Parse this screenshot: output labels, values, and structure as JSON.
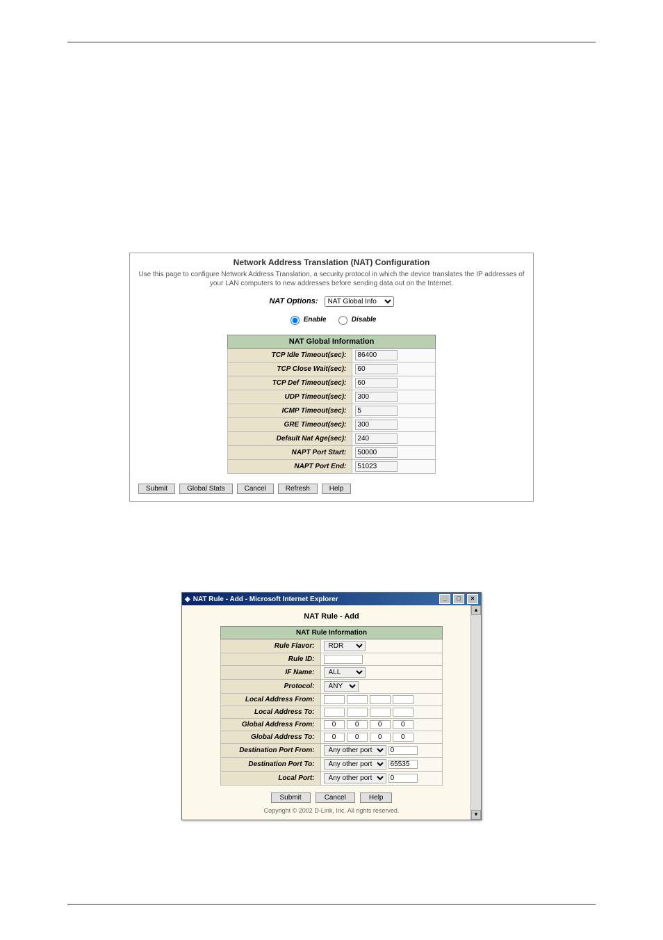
{
  "panel": {
    "title": "Network Address Translation (NAT) Configuration",
    "desc": "Use this page to configure Network Address Translation, a security protocol in which the device translates the IP addresses of your LAN computers to new addresses before sending data out on the Internet.",
    "options_label": "NAT Options:",
    "options_selected": "NAT Global Info",
    "enable_label": "Enable",
    "disable_label": "Disable"
  },
  "global": {
    "header": "NAT Global Information",
    "rows": [
      {
        "label": "TCP Idle Timeout(sec):",
        "value": "86400"
      },
      {
        "label": "TCP Close Wait(sec):",
        "value": "60"
      },
      {
        "label": "TCP Def Timeout(sec):",
        "value": "60"
      },
      {
        "label": "UDP Timeout(sec):",
        "value": "300"
      },
      {
        "label": "ICMP Timeout(sec):",
        "value": "5"
      },
      {
        "label": "GRE Timeout(sec):",
        "value": "300"
      },
      {
        "label": "Default Nat Age(sec):",
        "value": "240"
      },
      {
        "label": "NAPT Port Start:",
        "value": "50000"
      },
      {
        "label": "NAPT Port End:",
        "value": "51023"
      }
    ]
  },
  "buttons": {
    "submit": "Submit",
    "global_stats": "Global Stats",
    "cancel": "Cancel",
    "refresh": "Refresh",
    "help": "Help"
  },
  "rule_window": {
    "title": "NAT Rule - Add - Microsoft Internet Explorer",
    "page_title": "NAT Rule - Add",
    "table_header": "NAT Rule Information",
    "rule_flavor_label": "Rule Flavor:",
    "rule_flavor_value": "RDR",
    "rule_id_label": "Rule ID:",
    "rule_id_value": "",
    "if_name_label": "IF Name:",
    "if_name_value": "ALL",
    "protocol_label": "Protocol:",
    "protocol_value": "ANY",
    "local_addr_from_label": "Local Address From:",
    "local_addr_to_label": "Local Address To:",
    "global_addr_from_label": "Global Address From:",
    "global_addr_to_label": "Global Address To:",
    "dest_port_from_label": "Destination Port From:",
    "dest_port_from_sel": "Any other port",
    "dest_port_from_val": "0",
    "dest_port_to_label": "Destination Port To:",
    "dest_port_to_sel": "Any other port",
    "dest_port_to_val": "65535",
    "local_port_label": "Local Port:",
    "local_port_sel": "Any other port",
    "local_port_val": "0",
    "gaf": [
      "0",
      "0",
      "0",
      "0"
    ],
    "gat": [
      "0",
      "0",
      "0",
      "0"
    ],
    "btn_submit": "Submit",
    "btn_cancel": "Cancel",
    "btn_help": "Help",
    "copyright": "Copyright © 2002 D-Link, Inc. All rights reserved."
  }
}
